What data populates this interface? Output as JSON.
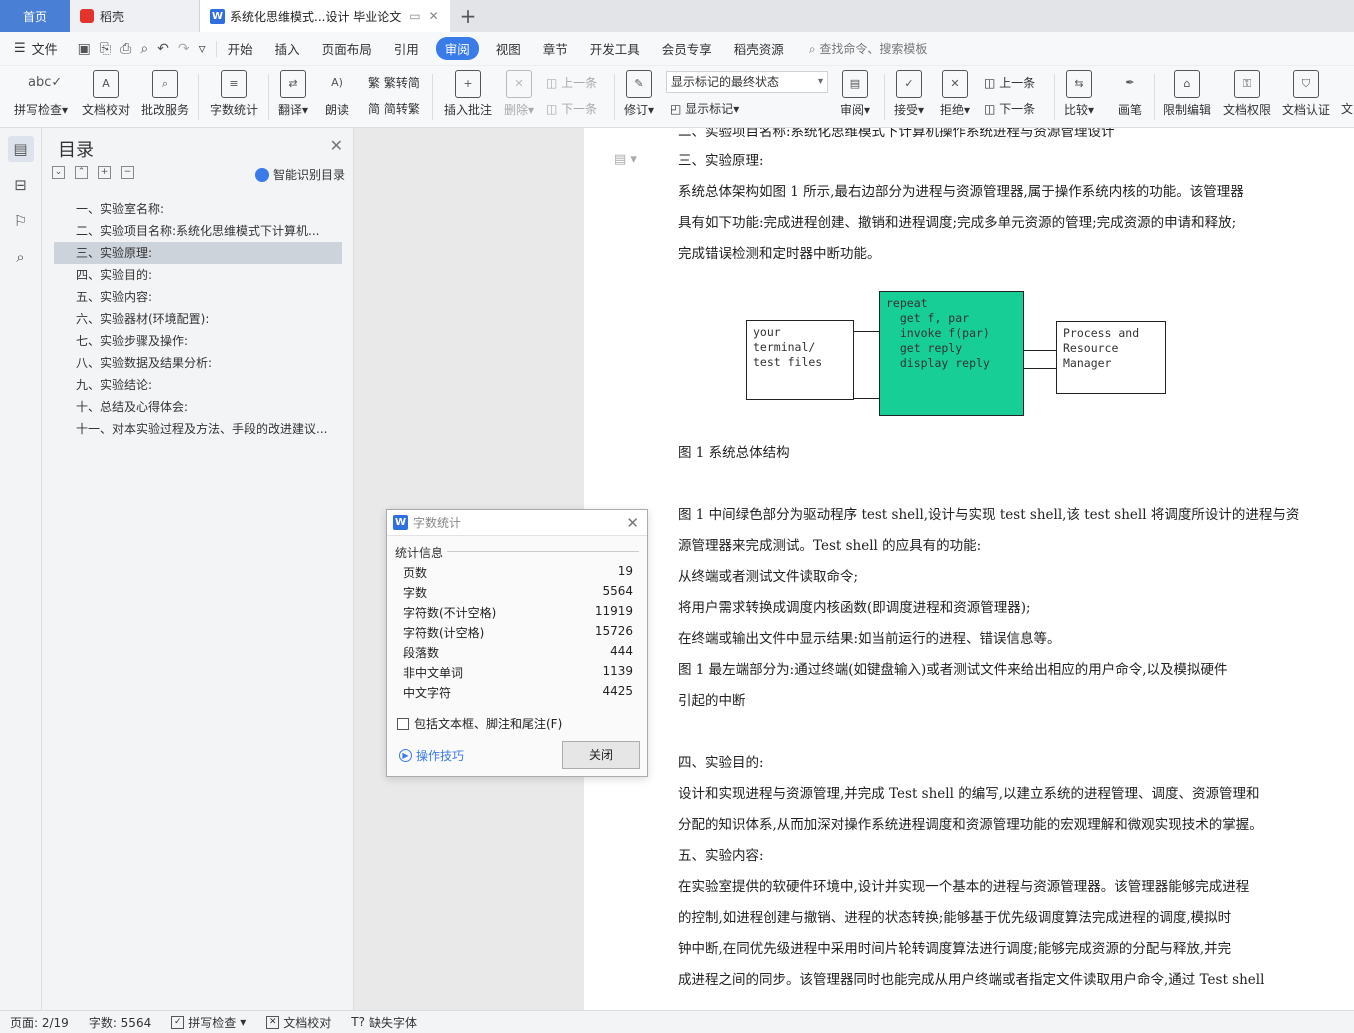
{
  "tabs": {
    "home": "首页",
    "daoke": "稻壳",
    "doc": "系统化思维模式...设计 毕业论文",
    "add": "+"
  },
  "menu": {
    "file": "文件",
    "items": [
      "开始",
      "插入",
      "页面布局",
      "引用",
      "审阅",
      "视图",
      "章节",
      "开发工具",
      "会员专享",
      "稻壳资源"
    ],
    "active": "审阅",
    "search": "查找命令、搜索模板"
  },
  "ribbon": {
    "spell": "拼写检查",
    "doc_check": "文档校对",
    "batch": "批改服务",
    "word_count": "字数统计",
    "translate": "翻译",
    "read": "朗读",
    "to_trad": "繁转简",
    "to_simp": "简转繁",
    "insert_comment": "插入批注",
    "delete": "删除",
    "prev": "上一条",
    "next": "下一条",
    "revise": "修订",
    "show_state": "显示标记的最终状态",
    "show_marks": "显示标记",
    "review": "审阅",
    "accept": "接受",
    "reject": "拒绝",
    "prev2": "上一条",
    "next2": "下一条",
    "compare": "比较",
    "pen": "画笔",
    "restrict": "限制编辑",
    "permission": "文档权限",
    "certify": "文档认证",
    "more": "文"
  },
  "outline": {
    "title": "目录",
    "smart": "智能识别目录",
    "items": [
      "一、实验室名称:",
      "二、实验项目名称:系统化思维模式下计算机...",
      "三、实验原理:",
      "四、实验目的:",
      "五、实验内容:",
      "六、实验器材(环境配置):",
      "七、实验步骤及操作:",
      "八、实验数据及结果分析:",
      "九、实验结论:",
      "十、总结及心得体会:",
      "十一、对本实验过程及方法、手段的改进建议..."
    ]
  },
  "doc": {
    "partial_top": "二、实验项目名称:系统化思维模式下计算机操作系统进程与资源管理设计",
    "lines_a": [
      "三、实验原理:",
      "系统总体架构如图 1 所示,最右边部分为进程与资源管理器,属于操作系统内核的功能。该管理器",
      "具有如下功能:完成进程创建、撤销和进程调度;完成多单元资源的管理;完成资源的申请和释放;",
      "完成错误检测和定时器中断功能。"
    ],
    "diagram": {
      "left": "your\nterminal/\ntest files",
      "center": "repeat\n  get f, par\n  invoke f(par)\n  get reply\n  display reply",
      "right": "Process and\nResource\nManager"
    },
    "caption": "图 1  系统总体结构",
    "lines_b": [
      "图 1 中间绿色部分为驱动程序 test shell,设计与实现 test shell,该 test shell 将调度所设计的进程与资",
      "源管理器来完成测试。Test shell 的应具有的功能:",
      "从终端或者测试文件读取命令;",
      "将用户需求转换成调度内核函数(即调度进程和资源管理器);",
      "在终端或输出文件中显示结果:如当前运行的进程、错误信息等。",
      "图 1 最左端部分为:通过终端(如键盘输入)或者测试文件来给出相应的用户命令,以及模拟硬件",
      "引起的中断",
      "",
      "四、实验目的:",
      "设计和实现进程与资源管理,并完成 Test shell 的编写,以建立系统的进程管理、调度、资源管理和",
      "分配的知识体系,从而加深对操作系统进程调度和资源管理功能的宏观理解和微观实现技术的掌握。",
      "五、实验内容:",
      "在实验室提供的软硬件环境中,设计并实现一个基本的进程与资源管理器。该管理器能够完成进程",
      "的控制,如进程创建与撤销、进程的状态转换;能够基于优先级调度算法完成进程的调度,模拟时",
      "钟中断,在同优先级进程中采用时间片轮转调度算法进行调度;能够完成资源的分配与释放,并完",
      "成进程之间的同步。该管理器同时也能完成从用户终端或者指定文件读取用户命令,通过 Test shell"
    ]
  },
  "dialog": {
    "title": "字数统计",
    "section": "统计信息",
    "rows": [
      {
        "label": "页数",
        "value": "19"
      },
      {
        "label": "字数",
        "value": "5564"
      },
      {
        "label": "字符数(不计空格)",
        "value": "11919"
      },
      {
        "label": "字符数(计空格)",
        "value": "15726"
      },
      {
        "label": "段落数",
        "value": "444"
      },
      {
        "label": "非中文单词",
        "value": "1139"
      },
      {
        "label": "中文字符",
        "value": "4425"
      }
    ],
    "include": "包括文本框、脚注和尾注(F)",
    "tips": "操作技巧",
    "close": "关闭"
  },
  "status": {
    "page": "页面: 2/19",
    "words": "字数: 5564",
    "spell": "拼写检查",
    "check": "文档校对",
    "font": "缺失字体"
  }
}
